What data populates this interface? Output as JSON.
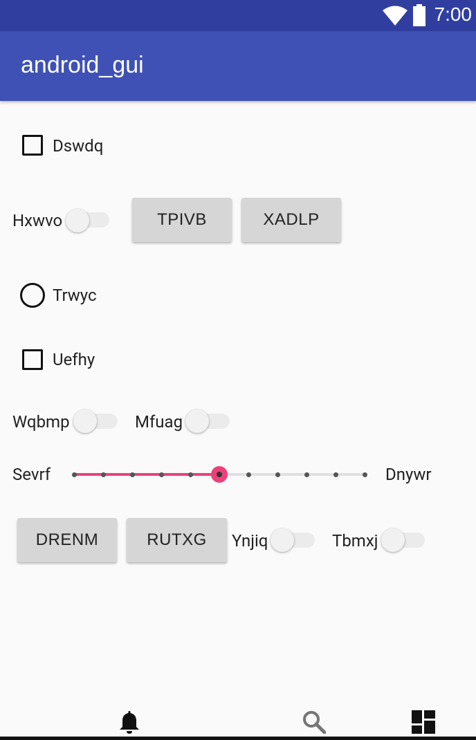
{
  "status_bar": {
    "time": "7:00",
    "icons": [
      "wifi-icon",
      "battery-icon"
    ]
  },
  "app_bar": {
    "title": "android_gui",
    "color": "#3f51b5",
    "status_color": "#303f9f"
  },
  "form": {
    "checkbox_1": {
      "label": "Dswdq",
      "checked": false
    },
    "switch_1": {
      "label": "Hxwvo",
      "on": false
    },
    "button_1": {
      "label": "TPIVB"
    },
    "button_2": {
      "label": "XADLP"
    },
    "radio_1": {
      "label": "Trwyc",
      "selected": false
    },
    "checkbox_2": {
      "label": "Uefhy",
      "checked": false
    },
    "switch_2": {
      "label": "Wqbmp",
      "on": false
    },
    "switch_3": {
      "label": "Mfuag",
      "on": false
    },
    "seekbar": {
      "left_label": "Sevrf",
      "right_label": "Dnywr",
      "value": 5,
      "max": 10,
      "accent": "#ec407a"
    },
    "button_3": {
      "label": "DRENM"
    },
    "button_4": {
      "label": "RUTXG"
    },
    "switch_4": {
      "label": "Ynjiq",
      "on": false
    },
    "switch_5": {
      "label": "Tbmxj",
      "on": false
    }
  },
  "bottom_nav": {
    "icons": [
      "notifications-icon",
      "search-icon",
      "dashboard-icon"
    ]
  }
}
